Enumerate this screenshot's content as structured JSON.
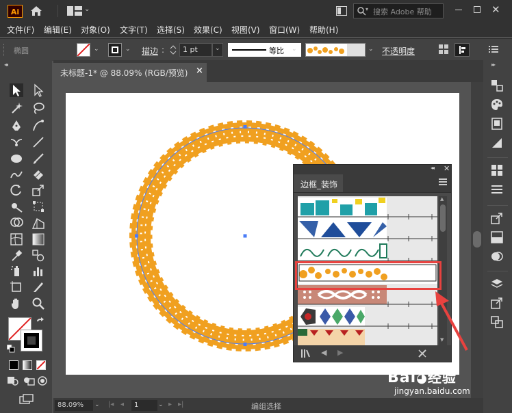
{
  "titlebar": {
    "app_logo": "Ai",
    "search_placeholder": "搜索 Adobe 帮助"
  },
  "menu": [
    "文件(F)",
    "编辑(E)",
    "对象(O)",
    "文字(T)",
    "选择(S)",
    "效果(C)",
    "视图(V)",
    "窗口(W)",
    "帮助(H)"
  ],
  "control_bar": {
    "selection_label": "椭圆",
    "stroke_label": "描边",
    "stroke_weight": "1 pt",
    "profile_label": "等比",
    "opacity_label": "不透明度"
  },
  "document": {
    "tab_title": "未标题-1* @ 88.09% (RGB/预览)",
    "close_glyph": "×"
  },
  "status_bar": {
    "zoom": "88.09%",
    "page": "1",
    "status_text": "编组选择"
  },
  "brush_panel": {
    "tab_label": "边框_装饰",
    "rows": [
      {
        "name": "brush-row-teal-yellow"
      },
      {
        "name": "brush-row-blue-zigzag"
      },
      {
        "name": "brush-row-green-swirl"
      },
      {
        "name": "brush-row-orange-ornament",
        "highlighted": true
      },
      {
        "name": "brush-row-rose-knot"
      },
      {
        "name": "brush-row-mosaic-diamond"
      },
      {
        "name": "brush-row-red-green-beige"
      }
    ]
  },
  "watermark": {
    "brand": "Bai",
    "brand_suffix": "经验",
    "url": "jingyan.baidu.com"
  },
  "colors": {
    "accent_orange": "#f0a020",
    "highlight_red": "#e8423f",
    "selection_blue": "#4a7cf7",
    "app_dark": "#323232",
    "panel_gray": "#424242"
  },
  "icons": [
    "home-icon",
    "workspace-icon",
    "search-icon",
    "selection-tool-icon",
    "direct-selection-tool-icon",
    "magic-wand-icon",
    "lasso-icon",
    "pen-icon",
    "curvature-icon",
    "type-icon",
    "line-icon",
    "ellipse-icon",
    "paintbrush-icon",
    "shaper-icon",
    "eraser-icon",
    "rotate-icon",
    "scale-icon",
    "warp-icon",
    "free-transform-icon",
    "shape-builder-icon",
    "perspective-icon",
    "mesh-icon",
    "gradient-icon",
    "eyedropper-icon",
    "blend-icon",
    "symbol-sprayer-icon",
    "graph-icon",
    "artboard-icon",
    "slice-icon",
    "hand-icon",
    "zoom-icon"
  ]
}
